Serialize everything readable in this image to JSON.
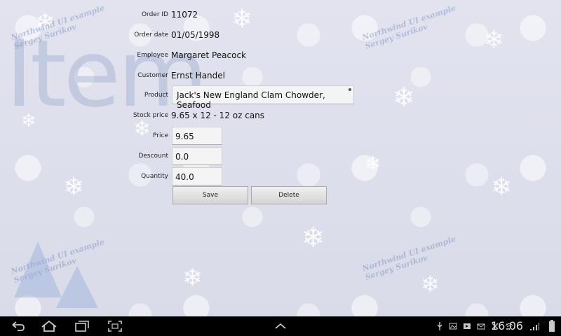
{
  "watermark": {
    "big_text": "Item",
    "caption_line1": "Northwind UI example",
    "caption_line2": "Sergey Surikov"
  },
  "form": {
    "order_id": {
      "label": "Order ID",
      "value": "11072"
    },
    "order_date": {
      "label": "Order date",
      "value": "01/05/1998"
    },
    "employee": {
      "label": "Employee",
      "value": "Margaret Peacock"
    },
    "customer": {
      "label": "Customer",
      "value": "Ernst Handel"
    },
    "product": {
      "label": "Product",
      "value": "Jack's New England Clam Chowder, Seafood"
    },
    "stock_price": {
      "label": "Stock price",
      "value": "9.65 x 12 - 12 oz cans"
    },
    "price": {
      "label": "Price",
      "value": "9.65"
    },
    "discount": {
      "label": "Descount",
      "value": "0.0"
    },
    "quantity": {
      "label": "Quantity",
      "value": "40.0"
    },
    "save_label": "Save",
    "delete_label": "Delete"
  },
  "navbar": {
    "clock": "16:06",
    "icons": [
      "back-icon",
      "home-icon",
      "recent-apps-icon",
      "screenshot-icon",
      "menu-up-icon"
    ],
    "status_icons": [
      "usb-icon",
      "image-icon",
      "play-icon",
      "mail-icon",
      "notification-icon",
      "wifi-icon",
      "signal-icon",
      "battery-icon"
    ]
  }
}
